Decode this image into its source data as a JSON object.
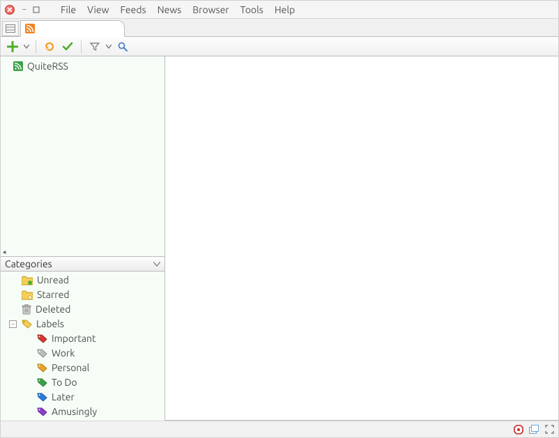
{
  "menu": [
    "File",
    "View",
    "Feeds",
    "News",
    "Browser",
    "Tools",
    "Help"
  ],
  "toolbar": {
    "add": "Add feed",
    "refresh": "Update",
    "markread": "Mark read",
    "filter": "Filter",
    "search": "Search"
  },
  "feeds": {
    "items": [
      {
        "label": "QuiteRSS",
        "icon": "rss-green-icon"
      }
    ]
  },
  "categories": {
    "header": "Categories",
    "items": [
      {
        "label": "Unread",
        "icon": "folder-unread-icon"
      },
      {
        "label": "Starred",
        "icon": "folder-starred-icon"
      },
      {
        "label": "Deleted",
        "icon": "trash-icon"
      },
      {
        "label": "Labels",
        "icon": "tag-yellow-icon",
        "expandable": true,
        "expanded": true
      }
    ],
    "labels": [
      {
        "label": "Important",
        "color": "#d23a2f"
      },
      {
        "label": "Work",
        "color": "#8a8a8a"
      },
      {
        "label": "Personal",
        "color": "#e8a12c"
      },
      {
        "label": "To Do",
        "color": "#3aa246"
      },
      {
        "label": "Later",
        "color": "#2b7bd9"
      },
      {
        "label": "Amusingly",
        "color": "#8a3fc7"
      }
    ]
  },
  "status": {
    "adblock": "AdBlock",
    "windows": "Windows",
    "fullscreen": "Fullscreen"
  }
}
